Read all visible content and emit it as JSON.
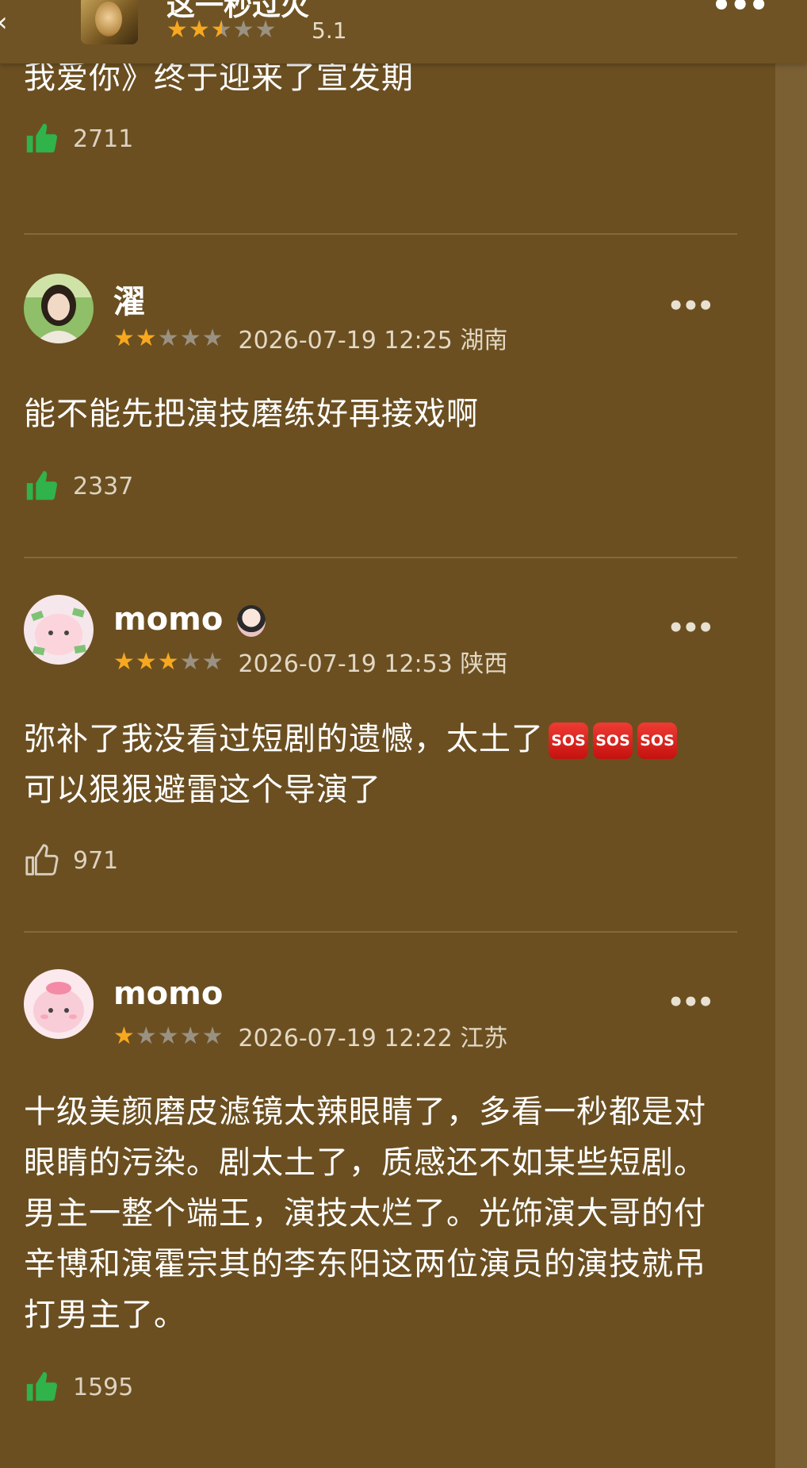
{
  "header": {
    "title": "这一秒过火",
    "rating_stars": 2.5,
    "score": "5.1"
  },
  "first_comment": {
    "text_tail": "我爱你》终于迎来了宣发期",
    "likes": "2711"
  },
  "comments": [
    {
      "username": "濯",
      "stars": 2,
      "datetime_location": "2026-07-19 12:25 湖南",
      "text": "能不能先把演技磨练好再接戏啊",
      "likes": "2337",
      "liked": true
    },
    {
      "username": "momo",
      "stars": 3,
      "datetime_location": "2026-07-19 12:53 陕西",
      "text_line1": "弥补了我没看过短剧的遗憾，太土了",
      "emoji": [
        "SOS",
        "SOS",
        "SOS"
      ],
      "text_line2": "可以狠狠避雷这个导演了",
      "likes": "971",
      "liked": false
    },
    {
      "username": "momo",
      "stars": 1,
      "datetime_location": "2026-07-19 12:22 江苏",
      "text": "十级美颜磨皮滤镜太辣眼睛了，多看一秒都是对眼睛的污染。剧太土了，质感还不如某些短剧。男主一整个端王，演技太烂了。光饰演大哥的付辛博和演霍宗其的李东阳这两位演员的演技就吊打男主了。",
      "likes": "1595",
      "liked": true
    }
  ],
  "colors": {
    "background": "#6b4f21",
    "star_active": "#f7a81f",
    "star_inactive": "#9a9182",
    "like_active": "#2fb34a",
    "sos_red": "#d41f1a"
  },
  "icons": [
    "back-icon",
    "more-icon",
    "thumbs-up-icon",
    "star-icon"
  ]
}
